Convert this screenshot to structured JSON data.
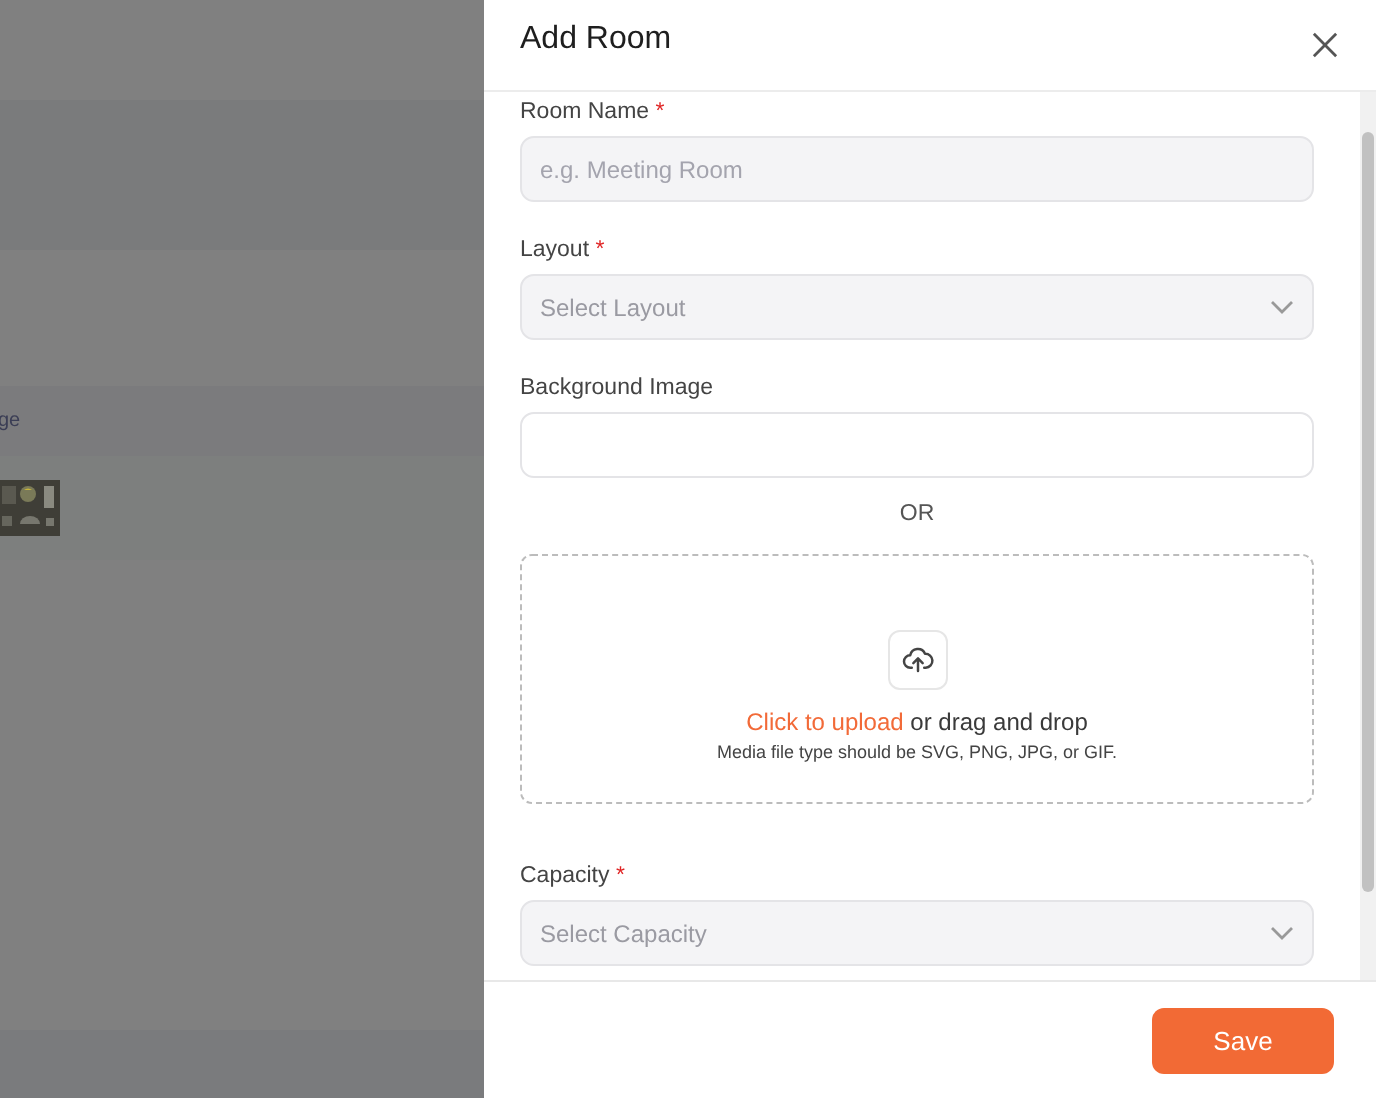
{
  "background": {
    "table": {
      "columns": [
        "ge"
      ]
    }
  },
  "dialog": {
    "title": "Add Room",
    "fields": [
      {
        "kind": "text",
        "label": "Room Name",
        "required_mark": "*",
        "placeholder": "e.g. Meeting Room"
      },
      {
        "kind": "select",
        "label": "Layout",
        "required_mark": "*",
        "placeholder": "Select Layout"
      },
      {
        "kind": "file",
        "label": "Background Image"
      },
      {
        "kind": "separator",
        "text": "OR"
      },
      {
        "kind": "dropzone",
        "link": "Click to upload",
        "text": "or drag and drop",
        "hint": "Media file type should be SVG, PNG, JPG, or GIF."
      },
      {
        "kind": "select",
        "label": "Capacity",
        "required_mark": "*",
        "placeholder": "Select Capacity"
      }
    ],
    "buttons": [
      {
        "label": "Save"
      }
    ]
  }
}
